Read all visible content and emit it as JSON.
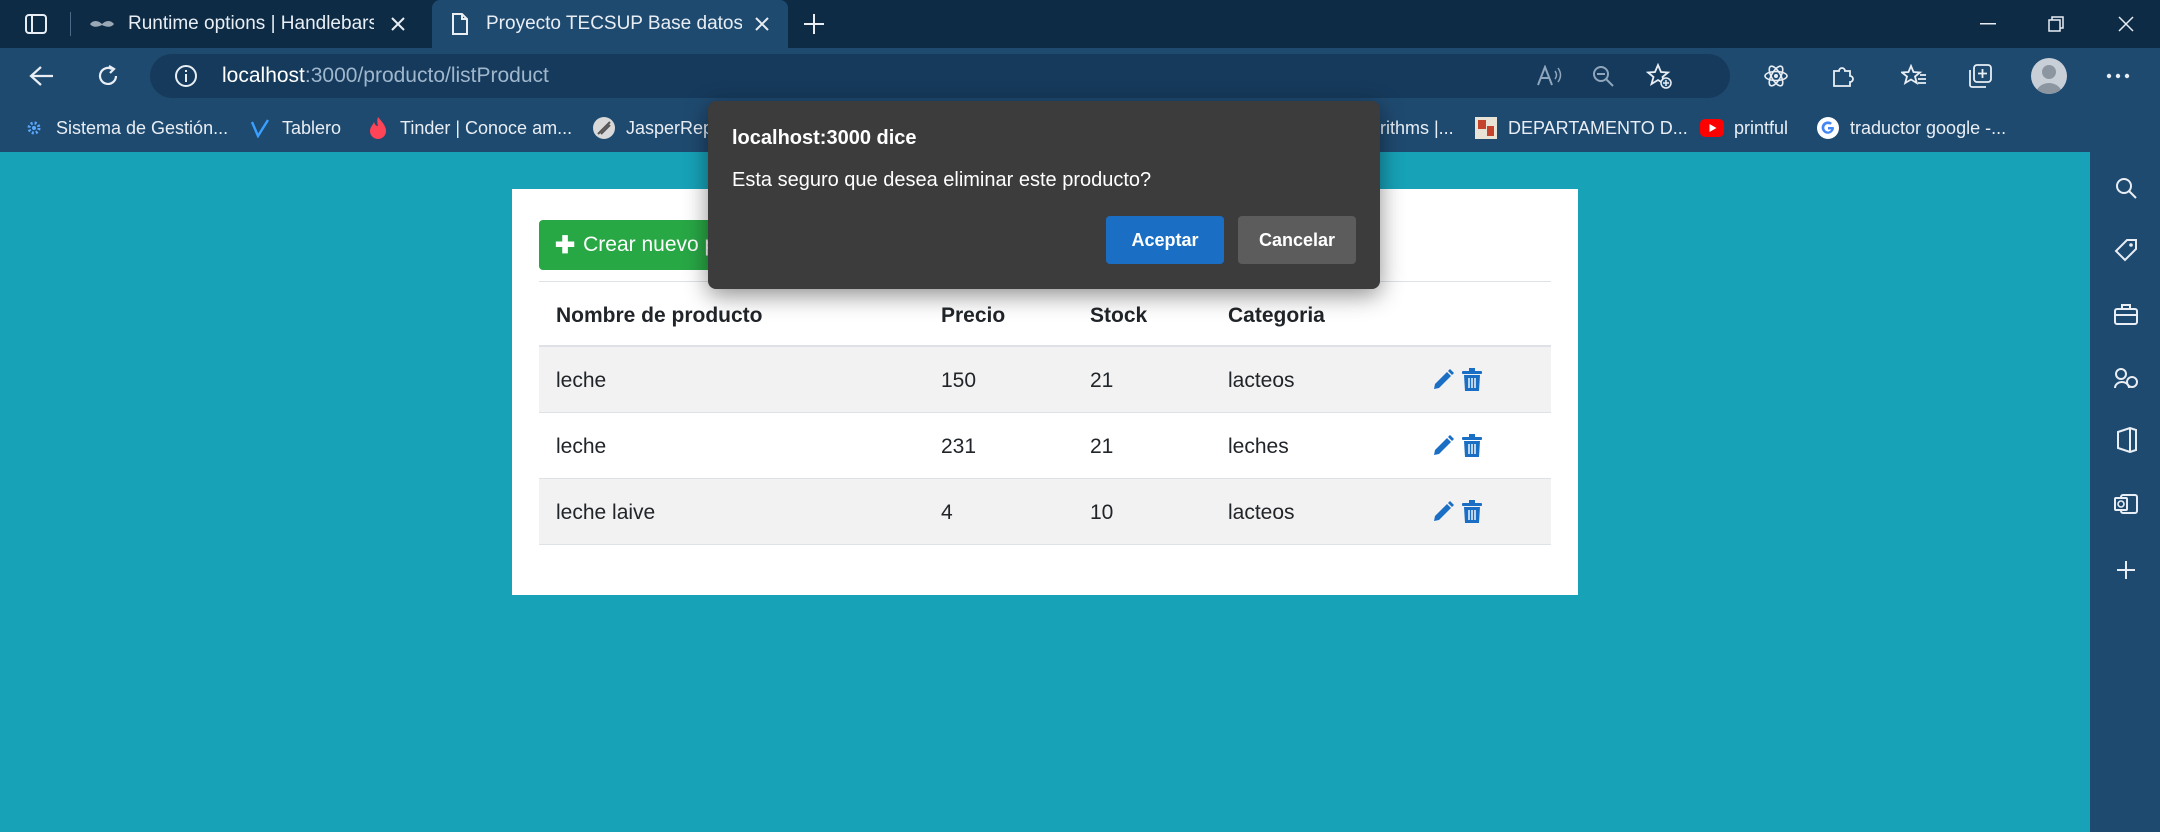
{
  "browser": {
    "tabs": [
      {
        "title": "Runtime options | Handlebars",
        "icon": "handlebars-mustache-icon"
      },
      {
        "title": "Proyecto TECSUP Base datos ava",
        "icon": "page-icon"
      }
    ],
    "address": {
      "host": "localhost",
      "path": ":3000/producto/listProduct"
    },
    "bookmarks": [
      {
        "label": "Sistema de Gestión...",
        "icon": "gear-logo-icon"
      },
      {
        "label": "Tablero",
        "icon": "vimeo-v-icon"
      },
      {
        "label": "Tinder | Conoce am...",
        "icon": "tinder-flame-icon"
      },
      {
        "label": "JasperRep",
        "icon": "jasper-icon"
      },
      {
        "label": "rithms |...",
        "icon": ""
      },
      {
        "label": "DEPARTAMENTO D...",
        "icon": "department-icon"
      },
      {
        "label": "printful",
        "icon": "youtube-icon"
      },
      {
        "label": "traductor google -...",
        "icon": "google-icon"
      }
    ],
    "accent": "#1a6fc4"
  },
  "page": {
    "create_button": "Crear nuevo p",
    "table": {
      "headers": [
        "Nombre de producto",
        "Precio",
        "Stock",
        "Categoria"
      ],
      "rows": [
        {
          "name": "leche",
          "price": "150",
          "stock": "21",
          "category": "lacteos"
        },
        {
          "name": "leche",
          "price": "231",
          "stock": "21",
          "category": "leches"
        },
        {
          "name": "leche laive",
          "price": "4",
          "stock": "10",
          "category": "lacteos"
        }
      ]
    }
  },
  "dialog": {
    "title": "localhost:3000 dice",
    "message": "Esta seguro que desea eliminar este producto?",
    "ok": "Aceptar",
    "cancel": "Cancelar"
  }
}
